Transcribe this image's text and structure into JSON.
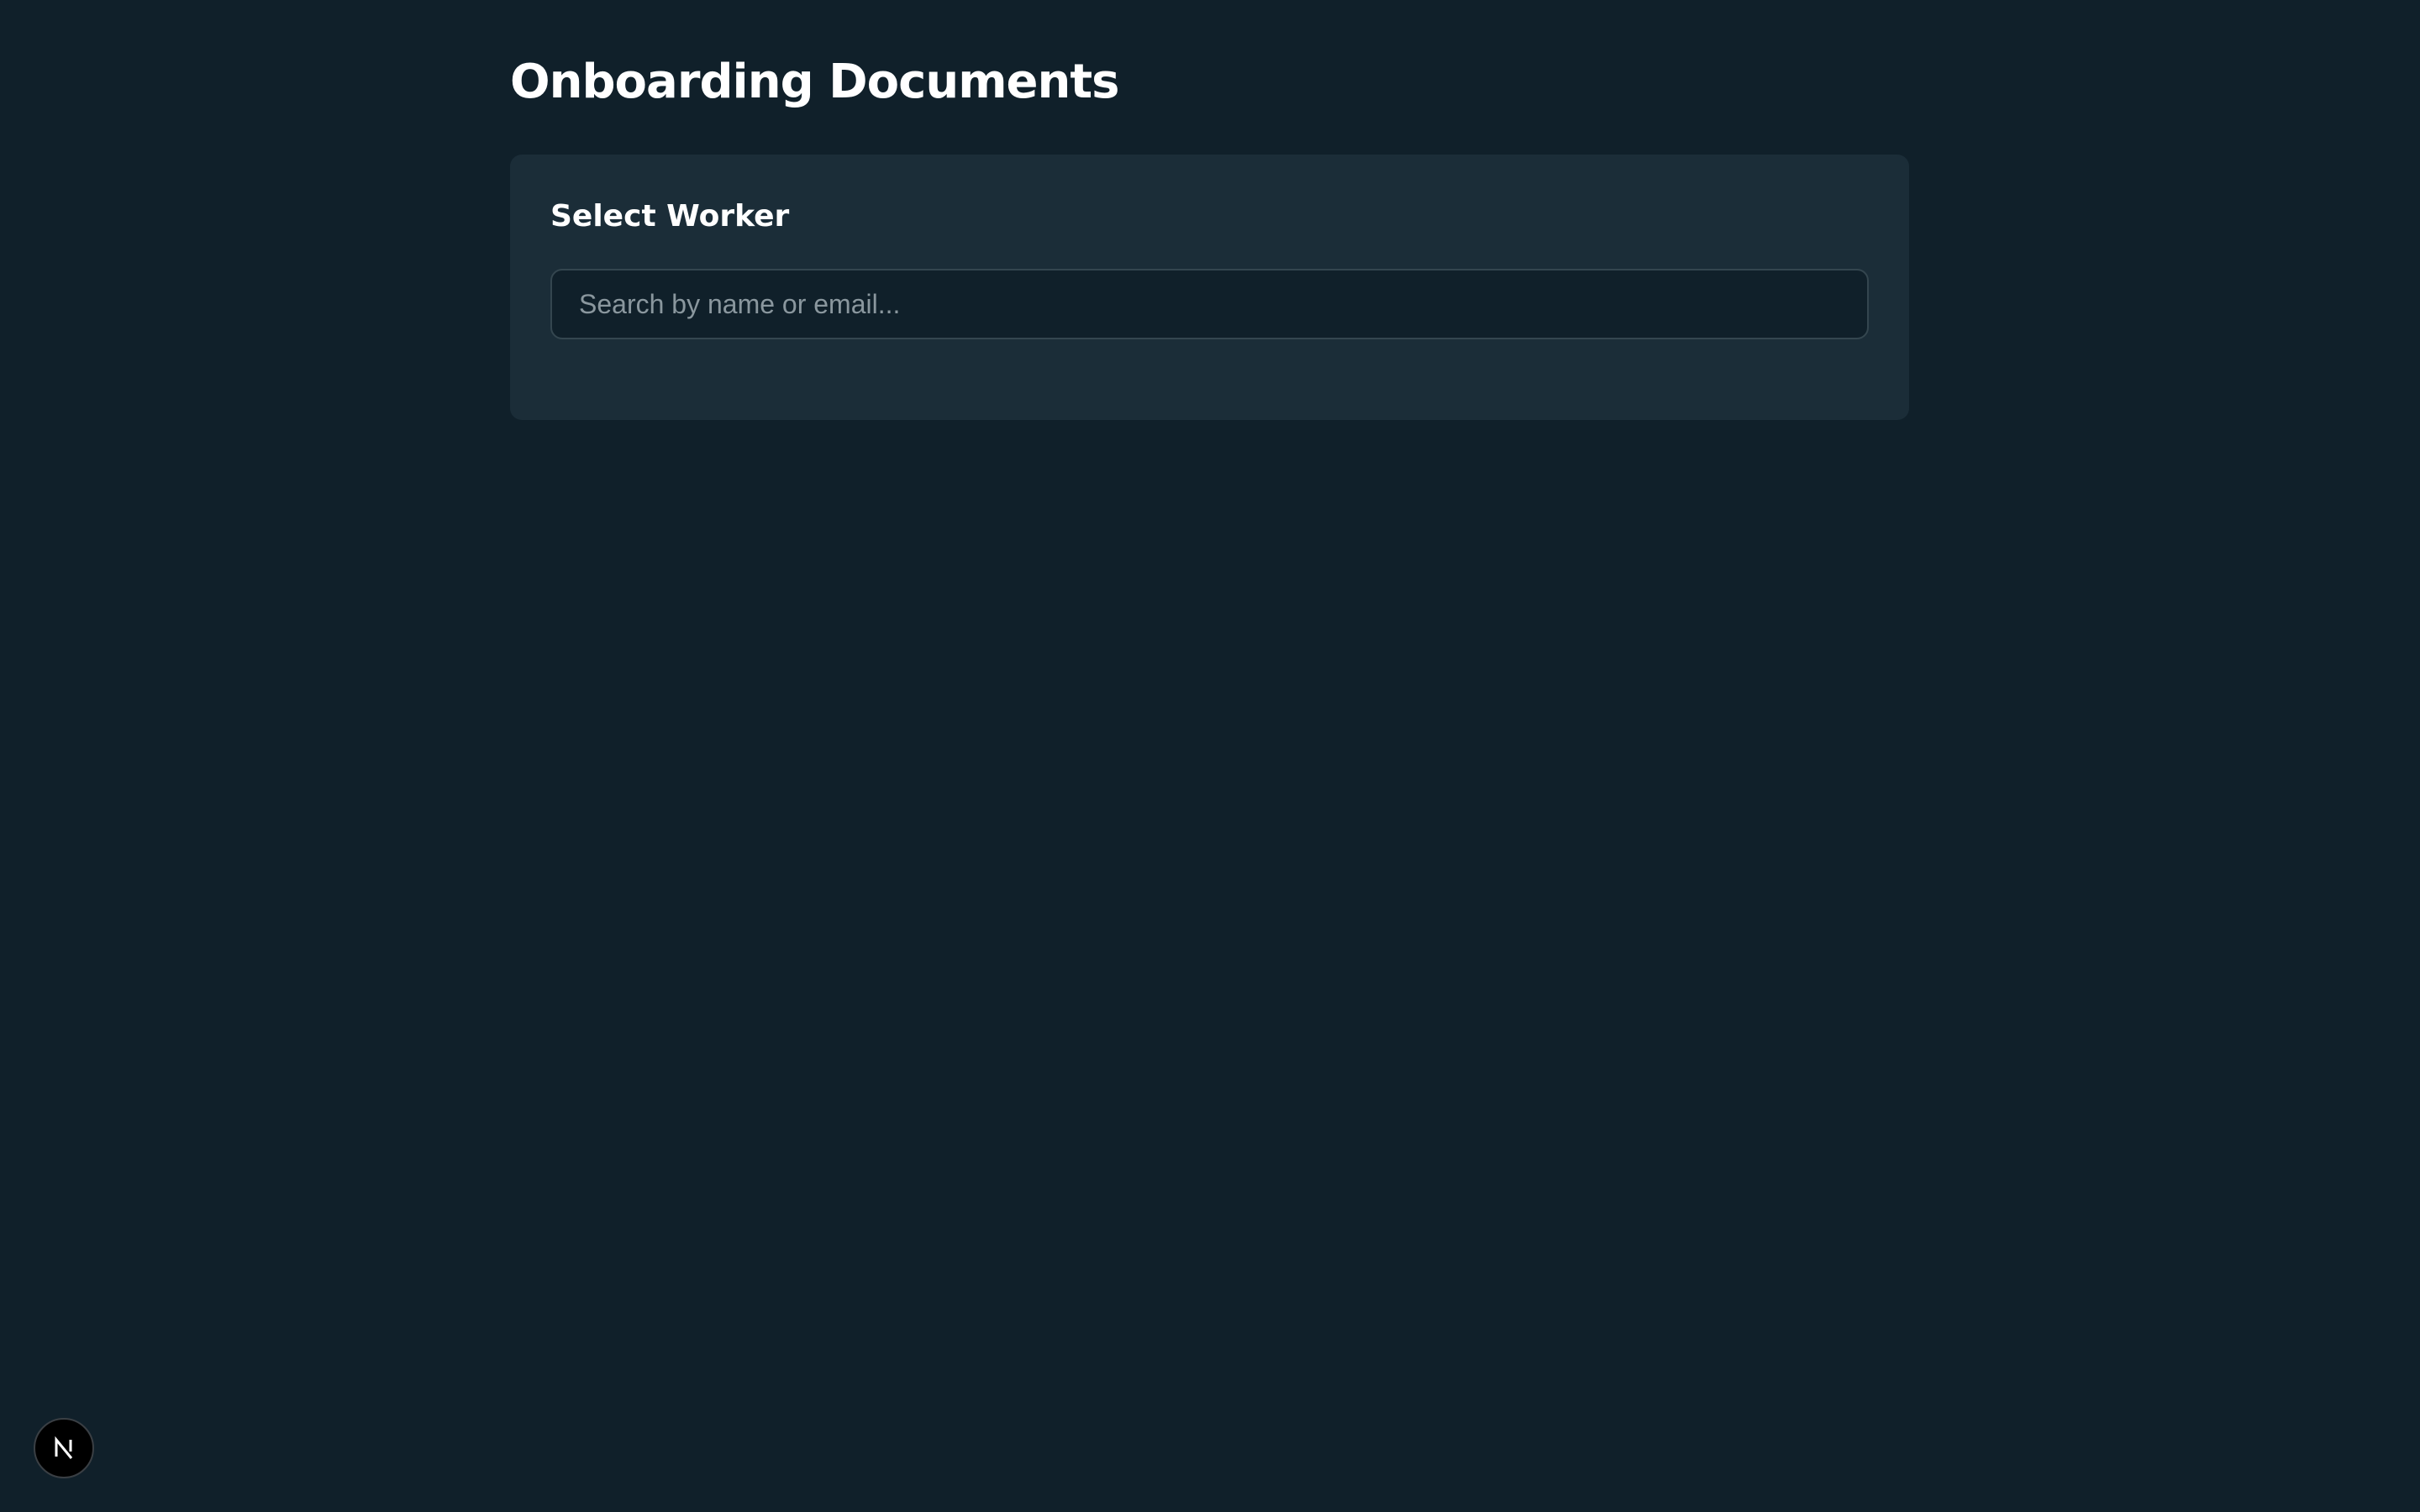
{
  "page": {
    "title": "Onboarding Documents"
  },
  "worker_select": {
    "title": "Select Worker",
    "search_placeholder": "Search by name or email...",
    "search_value": ""
  },
  "dev_badge": {
    "icon": "nextjs-logo-icon"
  },
  "colors": {
    "background": "#10202a",
    "card": "#1b2d38",
    "input_background": "#10202a",
    "input_border": "#34464f",
    "title_text": "#ffffff",
    "placeholder_text": "#8a979e"
  }
}
